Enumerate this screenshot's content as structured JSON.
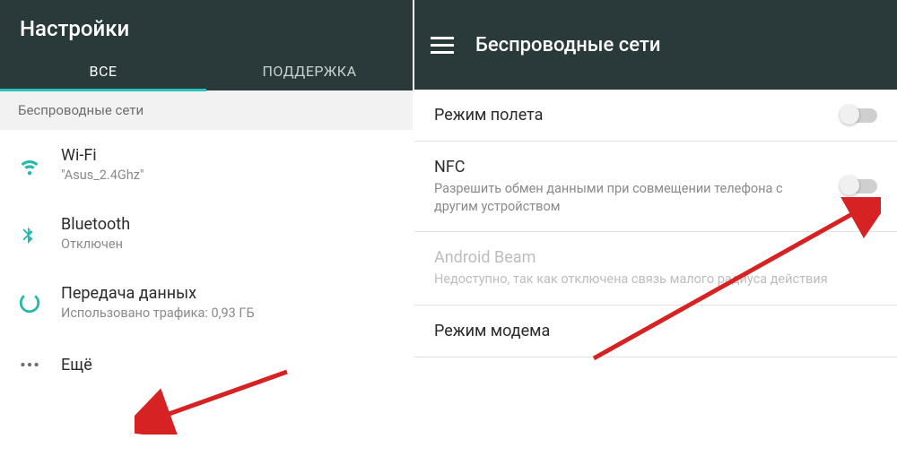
{
  "left": {
    "title": "Настройки",
    "tabs": {
      "all": "ВСЕ",
      "support": "ПОДДЕРЖКА"
    },
    "section": "Беспроводные сети",
    "items": [
      {
        "icon": "wifi-icon",
        "title": "Wi-Fi",
        "sub": "\"Asus_2.4Ghz\""
      },
      {
        "icon": "bluetooth-icon",
        "title": "Bluetooth",
        "sub": "Отключен"
      },
      {
        "icon": "data-usage-icon",
        "title": "Передача данных",
        "sub": "Использовано трафика: 0,93 ГБ"
      },
      {
        "icon": "more-icon",
        "title": "Ещё",
        "sub": ""
      }
    ]
  },
  "right": {
    "title": "Беспроводные сети",
    "items": [
      {
        "title": "Режим полета",
        "sub": "",
        "toggle": true,
        "disabled": false
      },
      {
        "title": "NFC",
        "sub": "Разрешить обмен данными при совмещении телефона с другим устройством",
        "toggle": true,
        "disabled": false
      },
      {
        "title": "Android Beam",
        "sub": "Недоступно, так как отключена связь малого радиуса действия",
        "toggle": false,
        "disabled": true
      },
      {
        "title": "Режим модема",
        "sub": "",
        "toggle": false,
        "disabled": false
      }
    ]
  },
  "colors": {
    "accent": "#27c4b8",
    "header": "#2a3a3a"
  }
}
